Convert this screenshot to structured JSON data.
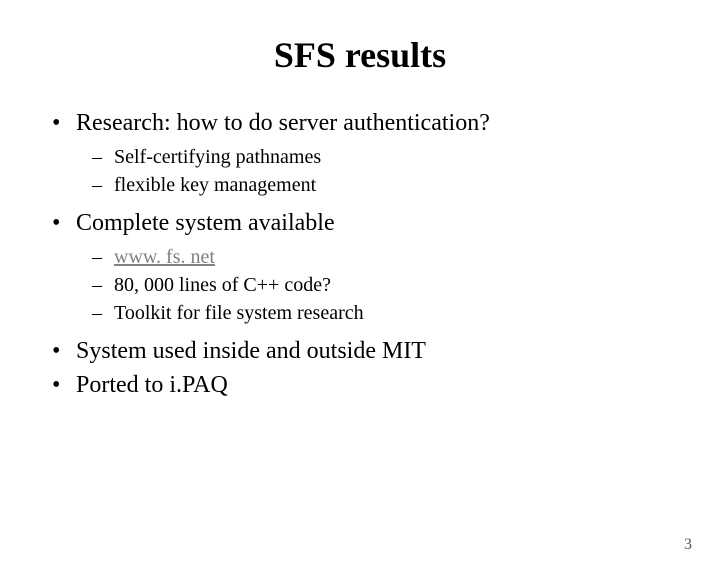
{
  "title": "SFS results",
  "bullets": {
    "b0": "Research: how to do server authentication?",
    "b0_sub": {
      "s0": "Self-certifying pathnames",
      "s1": "flexible key management"
    },
    "b1": "Complete system available",
    "b1_sub": {
      "s0": "www. fs. net",
      "s1": "80, 000 lines of C++ code?",
      "s2": "Toolkit for file system research"
    },
    "b2": "System used inside and outside MIT",
    "b3": "Ported to i.PAQ"
  },
  "page_number": "3"
}
